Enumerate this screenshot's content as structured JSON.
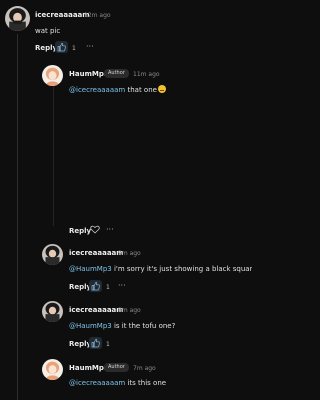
{
  "comments": [
    {
      "username": "icecreaaaaam",
      "time": "12m ago",
      "text": "wat pic",
      "reply_label": "Reply",
      "like_count": "1",
      "more_label": "···"
    },
    {
      "username": "HaumMp3",
      "badge": "Author",
      "time": "11m ago",
      "mention": "@icecreaaaaam",
      "text": " that one",
      "reply_label": "Reply",
      "more_label": "···"
    },
    {
      "username": "icecreaaaaam",
      "time": "9m ago",
      "mention": "@HaumMp3",
      "text": " i'm sorry it's just showing a black square",
      "reply_label": "Reply",
      "like_count": "1",
      "more_label": "···"
    },
    {
      "username": "icecreaaaaam",
      "time": "8m ago",
      "mention": "@HaumMp3",
      "text": " is it the tofu one?",
      "reply_label": "Reply",
      "like_count": "1"
    },
    {
      "username": "HaumMp3",
      "badge": "Author",
      "time": "7m ago",
      "mention": "@icecreaaaaam",
      "text": " its this one"
    }
  ],
  "colors": {
    "background": "#0e0e0e",
    "mention": "#7ec3ea",
    "like_button_bg": "#1f2a33"
  },
  "icons": {
    "like": "thumbs-up-icon",
    "heart": "heart-icon",
    "more": "more-icon",
    "emoji": "emoji-icon"
  }
}
